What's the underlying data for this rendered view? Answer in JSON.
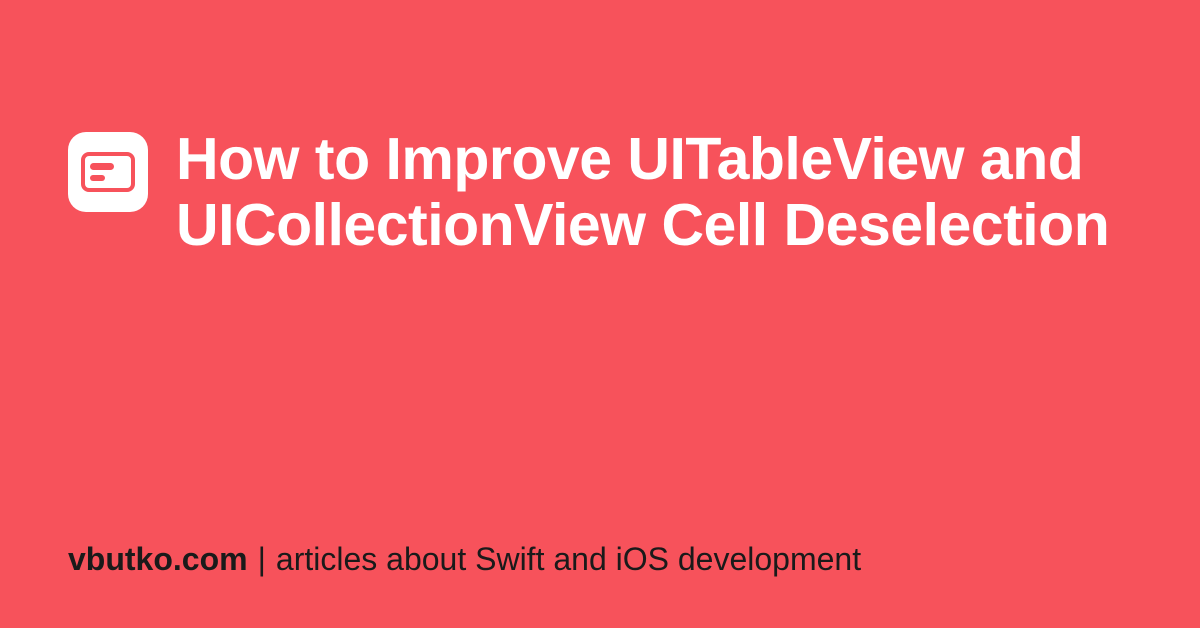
{
  "article": {
    "title": "How to Improve UITableView and UICollectionView Cell Deselection"
  },
  "footer": {
    "site": "vbutko.com",
    "separator": "|",
    "tagline": "articles about Swift and iOS development"
  },
  "colors": {
    "background": "#F7525B",
    "icon_bg": "#FFFFFF",
    "icon_fg": "#F7525B",
    "title": "#FFFFFF",
    "footer": "#1a1a1a"
  }
}
